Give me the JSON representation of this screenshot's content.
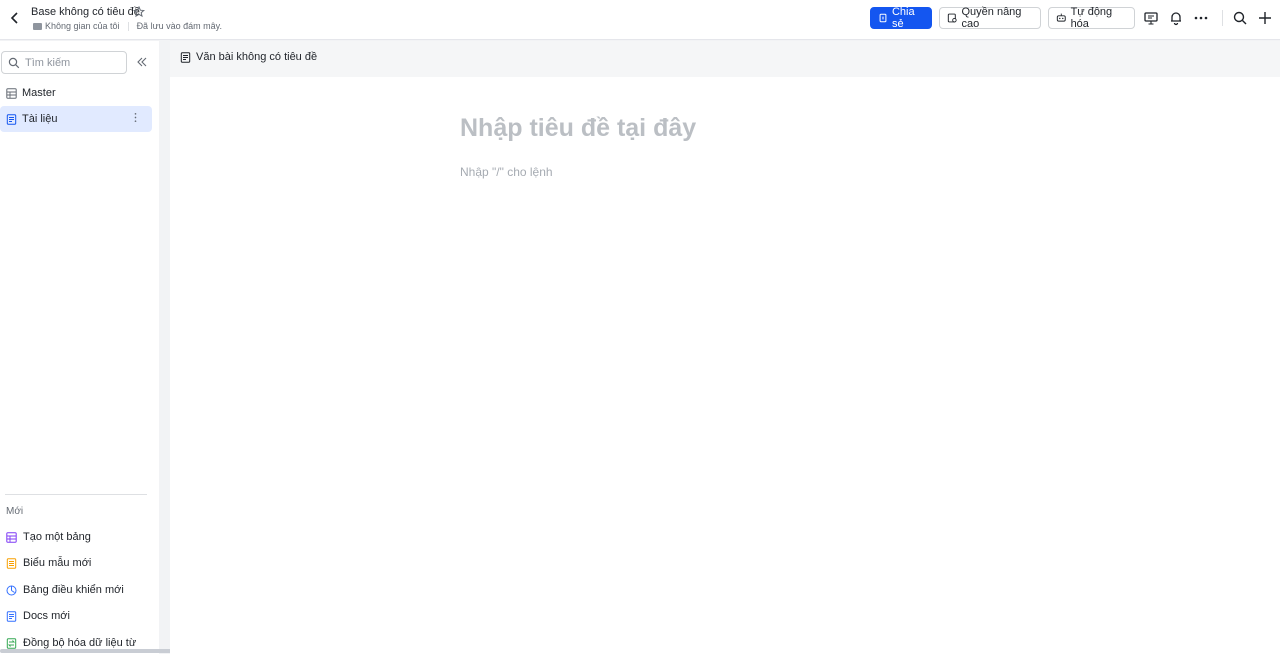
{
  "header": {
    "title": "Base không có tiêu đề",
    "breadcrumb_space": "Không gian của tôi",
    "save_status": "Đã lưu vào đám mây.",
    "share_label": "Chia sẻ",
    "permissions_label": "Quyền nâng cao",
    "automation_label": "Tự động hóa",
    "icons": [
      "back-icon",
      "star-icon",
      "presentation-icon",
      "bell-icon",
      "more-icon",
      "search-icon",
      "plus-icon"
    ],
    "accent_color": "#1456f0"
  },
  "sidebar": {
    "search_placeholder": "Tìm kiếm",
    "items": [
      {
        "label": "Master",
        "icon": "table-icon",
        "active": false
      },
      {
        "label": "Tài liệu",
        "icon": "document-icon",
        "active": true
      }
    ],
    "new_section_label": "Mới",
    "new_items": [
      {
        "label": "Tạo một bảng",
        "icon": "table-icon",
        "color": "#7f3bf5"
      },
      {
        "label": "Biểu mẫu mới",
        "icon": "form-icon",
        "color": "#f8a000"
      },
      {
        "label": "Bảng điều khiển mới",
        "icon": "dashboard-icon",
        "color": "#3370ff"
      },
      {
        "label": "Docs mới",
        "icon": "docs-icon",
        "color": "#3370ff"
      },
      {
        "label": "Đồng bộ hóa dữ liệu từ",
        "icon": "sync-icon",
        "color": "#34a853"
      }
    ]
  },
  "main": {
    "tab_label": "Văn bài không có tiêu đề",
    "title_placeholder": "Nhập tiêu đề tại đây",
    "body_placeholder": "Nhập \"/\" cho lệnh"
  }
}
